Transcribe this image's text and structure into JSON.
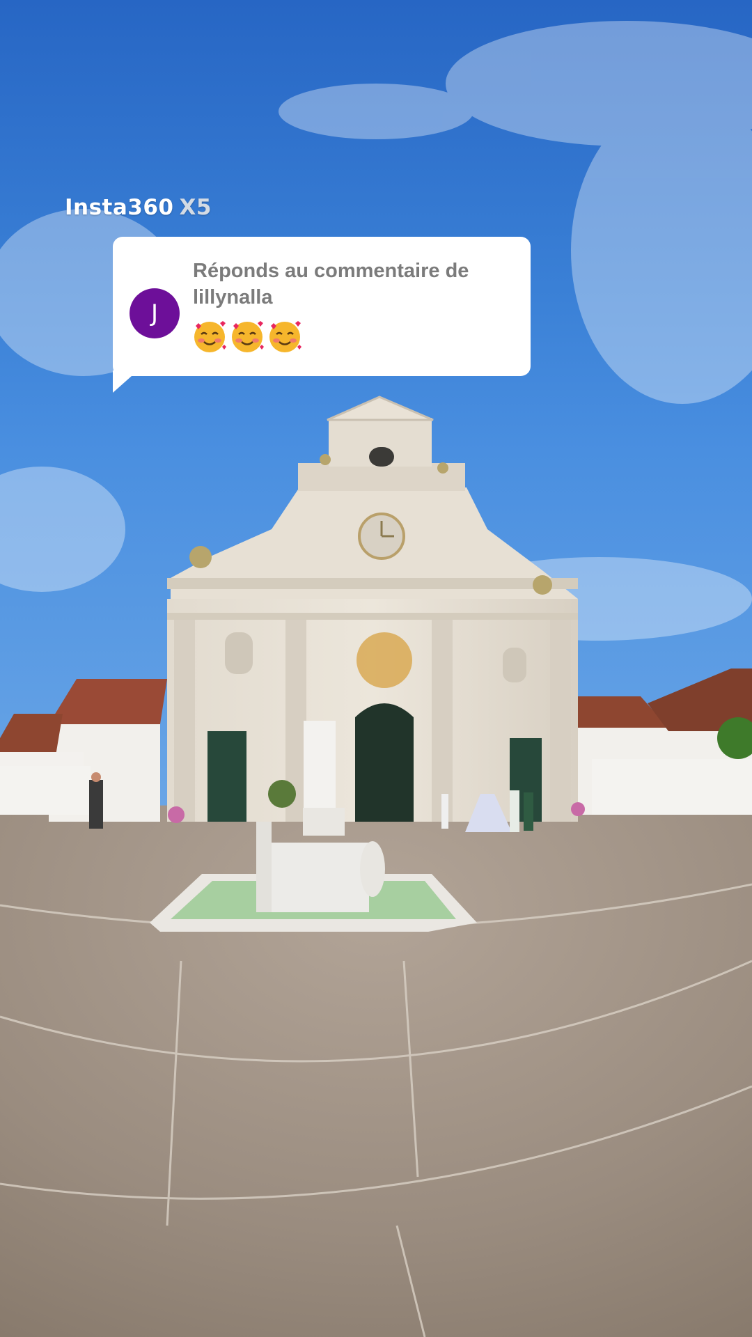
{
  "watermark": {
    "brand": "Insta360",
    "model": "X5"
  },
  "reply": {
    "avatar_initial": "J",
    "prompt": "Réponds au commentaire de lillynalla",
    "emojis": [
      "🥰",
      "🥰",
      "🥰"
    ]
  },
  "colors": {
    "avatar": "#6d0f99",
    "bubble": "#ffffff",
    "reply_text": "#7b7b7b"
  }
}
